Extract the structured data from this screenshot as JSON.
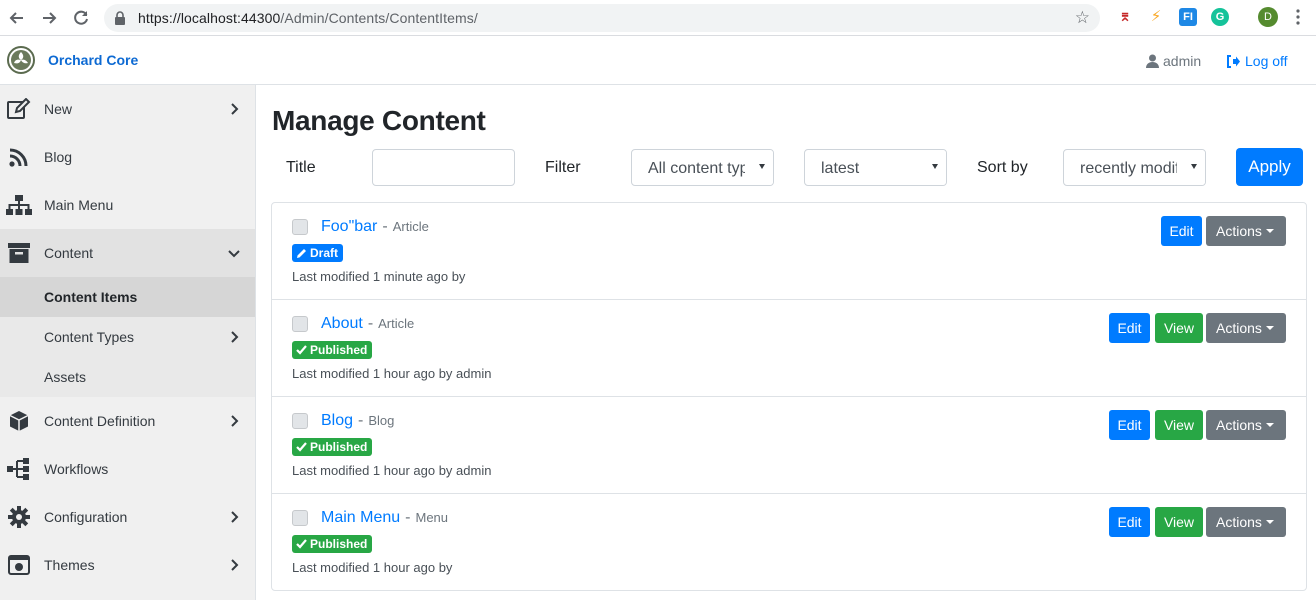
{
  "browser": {
    "url_scheme_host": "https://localhost:44300",
    "url_path": "/Admin/Contents/ContentItems/",
    "profile_initial": "D",
    "extensions": [
      {
        "name": "pdf-extension-icon",
        "color": "#c62828",
        "glyph": "⌆"
      },
      {
        "name": "lightning-extension-icon",
        "color": "#fbc02d",
        "glyph": "⚡"
      },
      {
        "name": "fi-extension-icon",
        "color": "#1e88e5",
        "glyph": "FI"
      },
      {
        "name": "grammarly-extension-icon",
        "color": "#15c39a",
        "glyph": "G"
      }
    ]
  },
  "appbar": {
    "brand": "Orchard Core",
    "user": "admin",
    "logoff": "Log off"
  },
  "sidebar": {
    "items": [
      {
        "label": "New",
        "icon": "edit-icon",
        "chevron": "right"
      },
      {
        "label": "Blog",
        "icon": "rss-icon",
        "chevron": ""
      },
      {
        "label": "Main Menu",
        "icon": "sitemap-icon",
        "chevron": ""
      },
      {
        "label": "Content",
        "icon": "archive-icon",
        "chevron": "down"
      },
      {
        "label": "Content Definition",
        "icon": "cube-icon",
        "chevron": "right"
      },
      {
        "label": "Workflows",
        "icon": "workflow-icon",
        "chevron": ""
      },
      {
        "label": "Configuration",
        "icon": "cog-icon",
        "chevron": "right"
      },
      {
        "label": "Themes",
        "icon": "themes-icon",
        "chevron": "right"
      }
    ],
    "subitems": [
      {
        "label": "Content Items",
        "current": true,
        "chevron": ""
      },
      {
        "label": "Content Types",
        "current": false,
        "chevron": "right"
      },
      {
        "label": "Assets",
        "current": false,
        "chevron": ""
      }
    ]
  },
  "main": {
    "title": "Manage Content",
    "filters": {
      "title_label": "Title",
      "title_value": "",
      "filter_label": "Filter",
      "content_type_selected": "All content types",
      "version_selected": "latest",
      "sort_label": "Sort by",
      "sort_selected": "recently modified",
      "apply_label": "Apply"
    },
    "items": [
      {
        "title": "Foo\"bar",
        "type": "Article",
        "status": "Draft",
        "modified": "Last modified 1 minute ago by",
        "buttons": [
          "Edit",
          "Actions"
        ]
      },
      {
        "title": "About",
        "type": "Article",
        "status": "Published",
        "modified": "Last modified 1 hour ago by admin",
        "buttons": [
          "Edit",
          "View",
          "Actions"
        ]
      },
      {
        "title": "Blog",
        "type": "Blog",
        "status": "Published",
        "modified": "Last modified 1 hour ago by admin",
        "buttons": [
          "Edit",
          "View",
          "Actions"
        ]
      },
      {
        "title": "Main Menu",
        "type": "Menu",
        "status": "Published",
        "modified": "Last modified 1 hour ago by",
        "buttons": [
          "Edit",
          "View",
          "Actions"
        ]
      }
    ]
  },
  "colors": {
    "primary": "#007bff",
    "success": "#28a745",
    "secondary": "#6c757d",
    "sidebar_bg": "#f0f0f0"
  }
}
